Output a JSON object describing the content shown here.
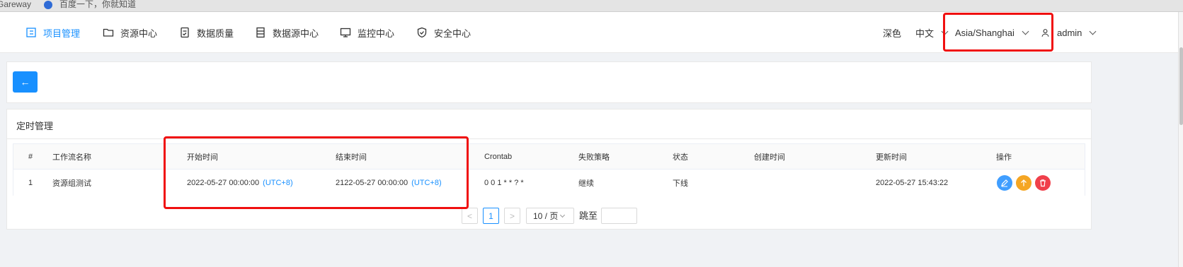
{
  "bookmarks": [
    {
      "label": "Gareway"
    },
    {
      "label": "百度一下，你就知道"
    }
  ],
  "nav": {
    "items": [
      {
        "label": "项目管理",
        "icon": "project-icon",
        "active": true
      },
      {
        "label": "资源中心",
        "icon": "folder-icon"
      },
      {
        "label": "数据质量",
        "icon": "quality-icon"
      },
      {
        "label": "数据源中心",
        "icon": "datasource-icon"
      },
      {
        "label": "监控中心",
        "icon": "monitor-icon"
      },
      {
        "label": "安全中心",
        "icon": "shield-icon"
      }
    ],
    "theme_label": "深色",
    "language_label": "中文",
    "timezone_label": "Asia/Shanghai",
    "user_label": "admin"
  },
  "back_button": {
    "icon": "arrow-left-icon",
    "glyph": "←"
  },
  "card": {
    "title": "定时管理"
  },
  "table": {
    "columns": [
      "#",
      "工作流名称",
      "开始时间",
      "结束时间",
      "Crontab",
      "失败策略",
      "状态",
      "创建时间",
      "更新时间",
      "操作"
    ],
    "rows": [
      {
        "index": "1",
        "workflow": "资源组测试",
        "start_time": "2022-05-27 00:00:00",
        "start_tz": "(UTC+8)",
        "end_time": "2122-05-27 00:00:00",
        "end_tz": "(UTC+8)",
        "crontab": "0 0 1 * * ? *",
        "failure_strategy": "继续",
        "status": "下线",
        "create_time": "",
        "update_time": "2022-05-27 15:43:22"
      }
    ],
    "actions": [
      {
        "name": "edit",
        "icon": "pencil-icon",
        "color": "#409eff"
      },
      {
        "name": "online",
        "icon": "arrow-up-icon",
        "color": "#f5a623"
      },
      {
        "name": "delete",
        "icon": "trash-icon",
        "color": "#f0404b"
      }
    ]
  },
  "pagination": {
    "prev": "<",
    "current_page": "1",
    "next": ">",
    "page_size": "10 / 页",
    "jump_label": "跳至",
    "jump_value": ""
  },
  "colors": {
    "primary": "#1890ff",
    "highlight": "#f01010"
  }
}
